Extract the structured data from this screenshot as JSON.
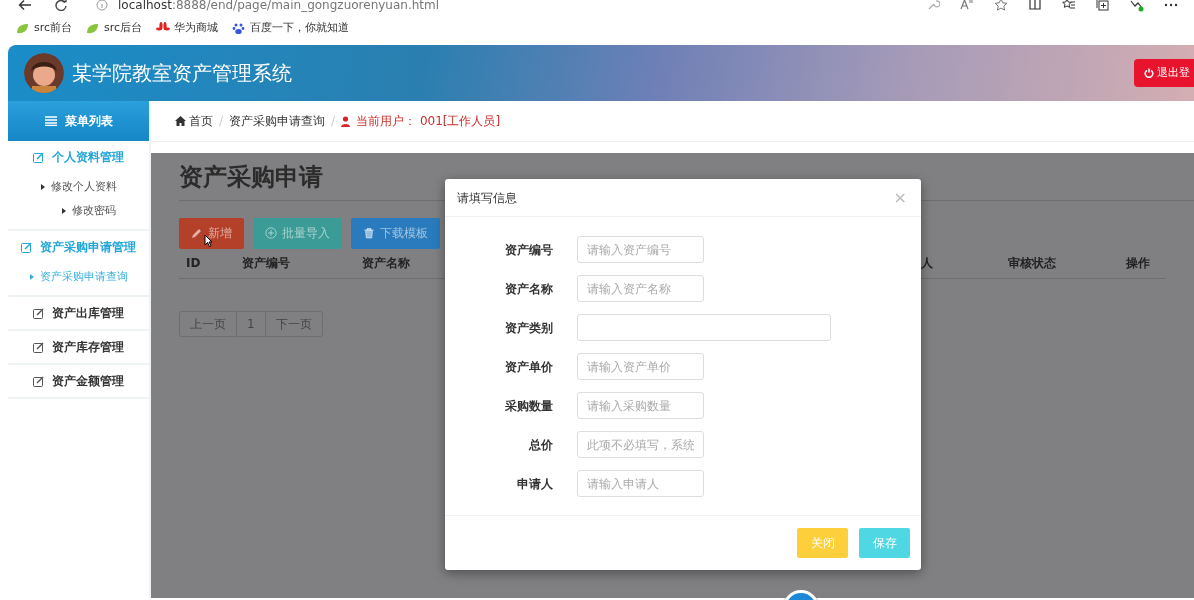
{
  "browser": {
    "url_host": "localhost",
    "url_rest": ":8888/end/page/main_gongzuorenyuan.html"
  },
  "bookmarks": [
    {
      "label": "src前台"
    },
    {
      "label": "src后台"
    },
    {
      "label": "华为商城"
    },
    {
      "label": "百度一下，你就知道"
    }
  ],
  "header": {
    "title": "某学院教室资产管理系统",
    "logout": "退出登"
  },
  "sidebar": {
    "title": "菜单列表",
    "groups": [
      {
        "label": "个人资料管理",
        "expanded": true,
        "children": [
          {
            "label": "修改个人资料",
            "selected": false
          },
          {
            "label": "修改密码",
            "selected": false
          }
        ]
      },
      {
        "label": "资产采购申请管理",
        "expanded": true,
        "children": [
          {
            "label": "资产采购申请查询",
            "selected": true
          }
        ]
      },
      {
        "label": "资产出库管理",
        "expanded": false
      },
      {
        "label": "资产库存管理",
        "expanded": false
      },
      {
        "label": "资产金额管理",
        "expanded": false
      }
    ]
  },
  "breadcrumb": {
    "home": "首页",
    "separators": [
      "/",
      "/"
    ],
    "current": "资产采购申请查询",
    "user": "当前用户： 001[工作人员]"
  },
  "page": {
    "title": "资产采购申请",
    "buttons": [
      {
        "label": "新增",
        "color": "#b5402a"
      },
      {
        "label": "批量导入",
        "color": "#3b9c97"
      },
      {
        "label": "下载模板",
        "color": "#2a7bbd"
      }
    ],
    "table": {
      "columns": [
        "ID",
        "资产编号",
        "资产名称",
        "人",
        "审核状态",
        "操作"
      ]
    },
    "pagination": [
      "上一页",
      "1",
      "下一页"
    ]
  },
  "modal": {
    "title": "请填写信息",
    "close": "×",
    "fields": [
      {
        "label": "资产编号",
        "kind": "input",
        "placeholder": "请输入资产编号"
      },
      {
        "label": "资产名称",
        "kind": "input",
        "placeholder": "请输入资产名称"
      },
      {
        "label": "资产类别",
        "kind": "select"
      },
      {
        "label": "资产单价",
        "kind": "input",
        "placeholder": "请输入资产单价"
      },
      {
        "label": "采购数量",
        "kind": "input",
        "placeholder": "请输入采购数量"
      },
      {
        "label": "总价",
        "kind": "input",
        "placeholder": "此项不必填写，系统"
      },
      {
        "label": "申请人",
        "kind": "input",
        "placeholder": "请输入申请人"
      }
    ],
    "buttons": [
      {
        "label": "关闭",
        "color": "#fdd03b"
      },
      {
        "label": "保存",
        "color": "#4fd7e4"
      }
    ]
  }
}
